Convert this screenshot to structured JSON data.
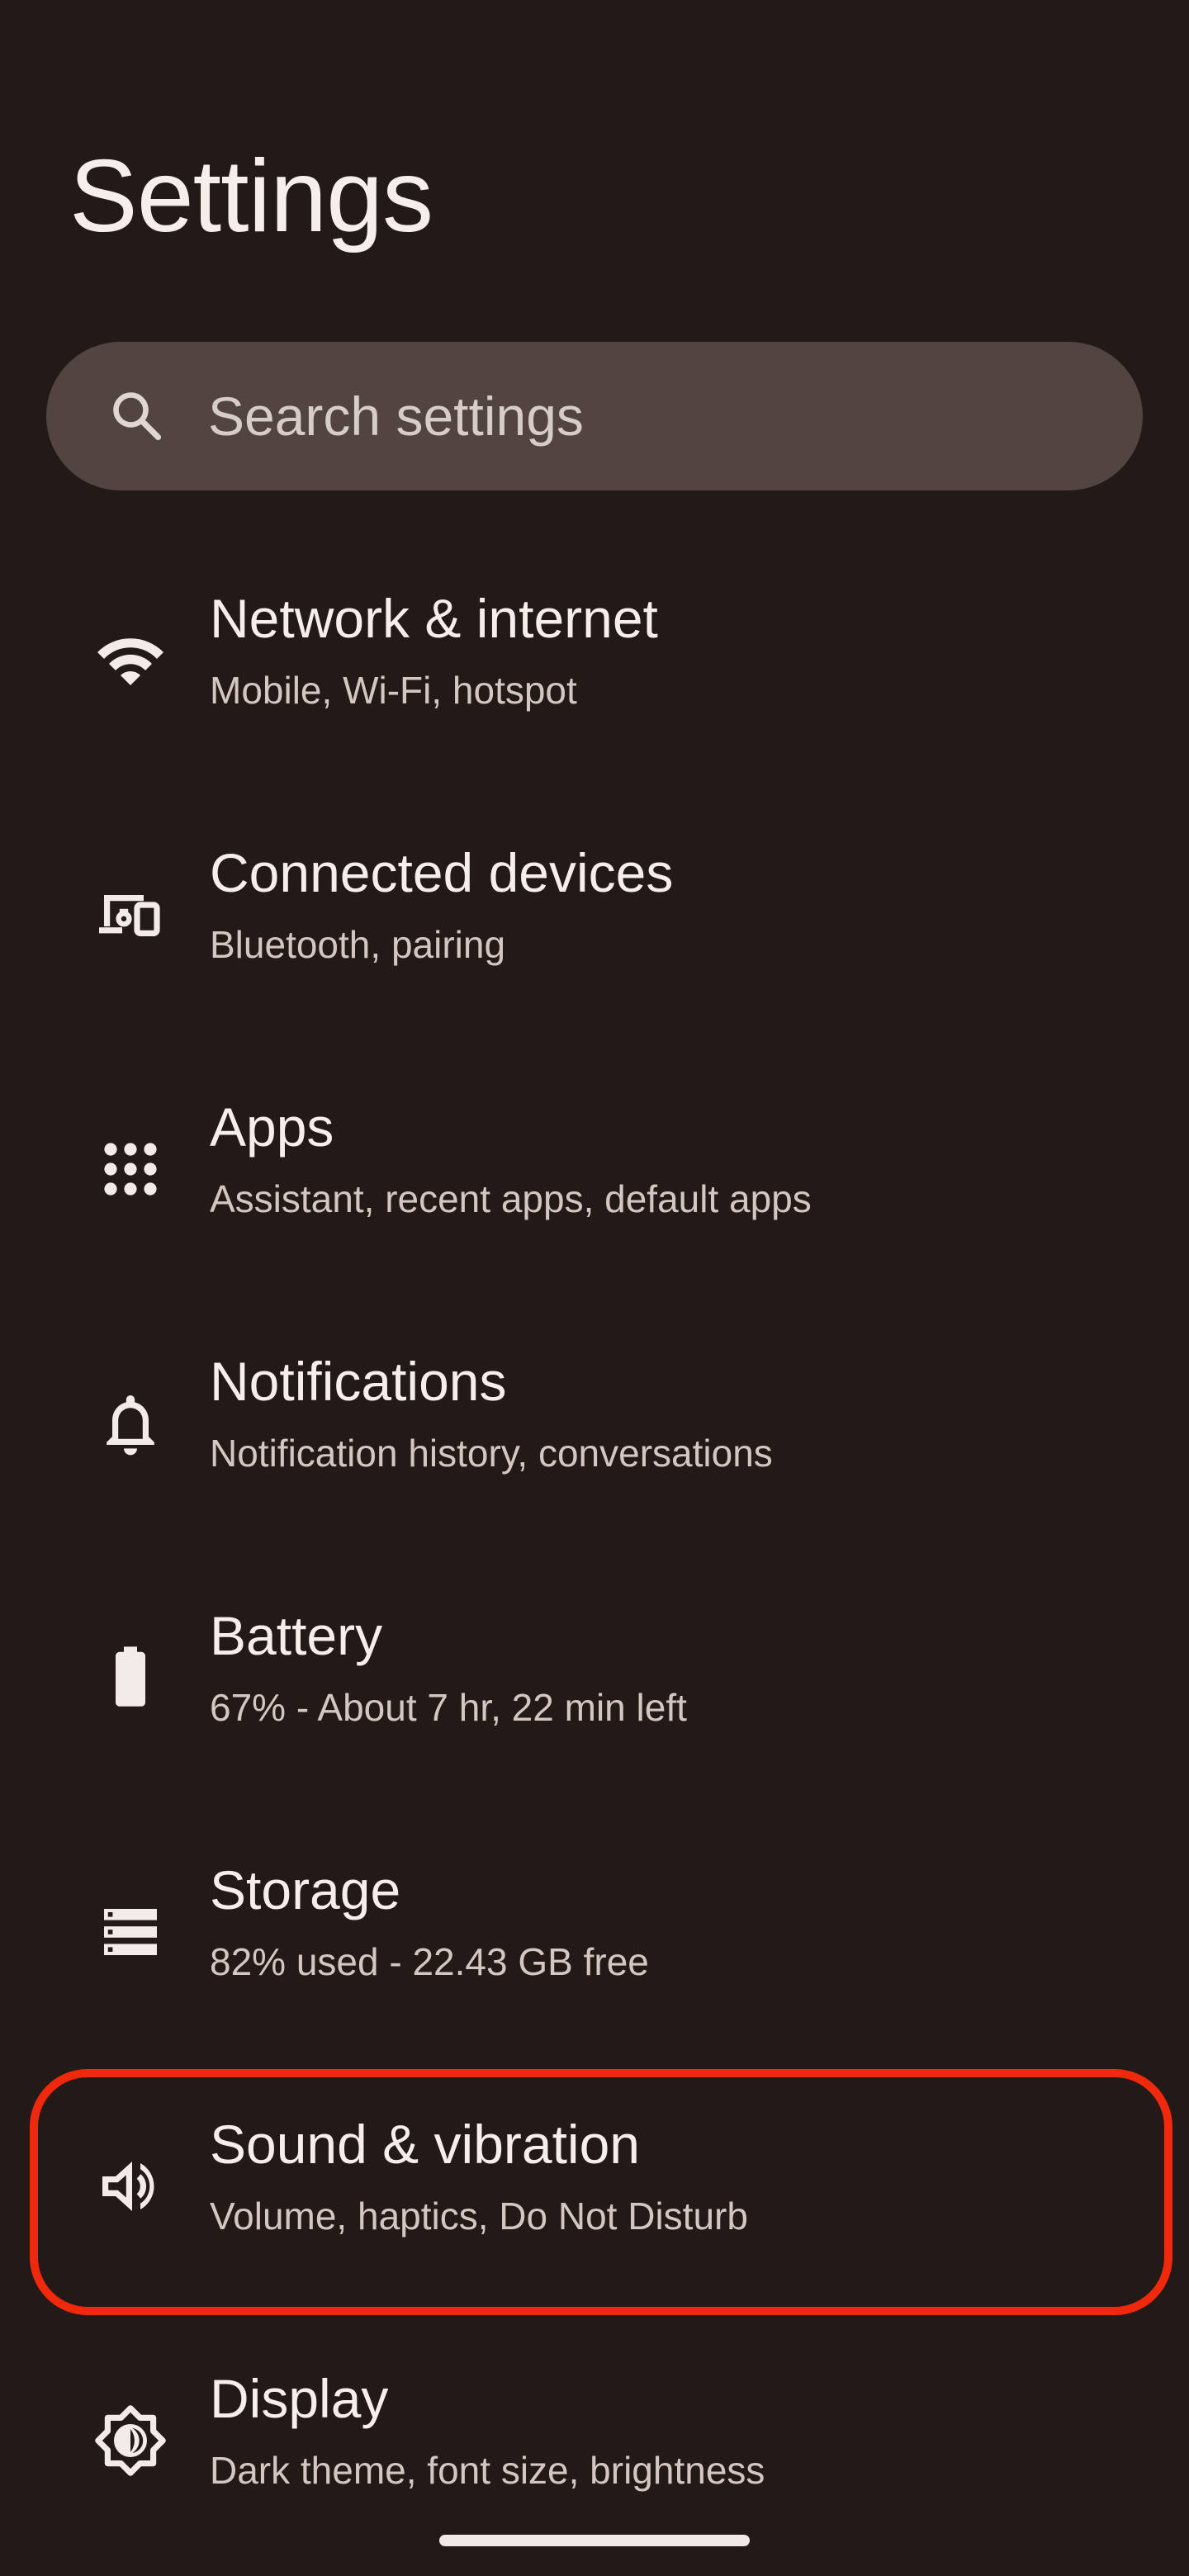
{
  "header": {
    "title": "Settings"
  },
  "search": {
    "placeholder": "Search settings",
    "icon": "search-icon"
  },
  "items": [
    {
      "title": "Network & internet",
      "subtitle": "Mobile, Wi-Fi, hotspot",
      "icon": "wifi-icon"
    },
    {
      "title": "Connected devices",
      "subtitle": "Bluetooth, pairing",
      "icon": "devices-icon"
    },
    {
      "title": "Apps",
      "subtitle": "Assistant, recent apps, default apps",
      "icon": "apps-grid-icon"
    },
    {
      "title": "Notifications",
      "subtitle": "Notification history, conversations",
      "icon": "bell-icon"
    },
    {
      "title": "Battery",
      "subtitle": "67% - About 7 hr, 22 min left",
      "icon": "battery-icon"
    },
    {
      "title": "Storage",
      "subtitle": "82% used - 22.43 GB free",
      "icon": "storage-icon"
    },
    {
      "title": "Sound & vibration",
      "subtitle": "Volume, haptics, Do Not Disturb",
      "icon": "speaker-icon",
      "highlighted": true
    },
    {
      "title": "Display",
      "subtitle": "Dark theme, font size, brightness",
      "icon": "brightness-icon"
    }
  ],
  "colors": {
    "background": "#231a18",
    "search_background": "#524541",
    "highlight": "#f0280c",
    "text_primary": "#f6eeea",
    "text_secondary": "#d4c6c2"
  }
}
